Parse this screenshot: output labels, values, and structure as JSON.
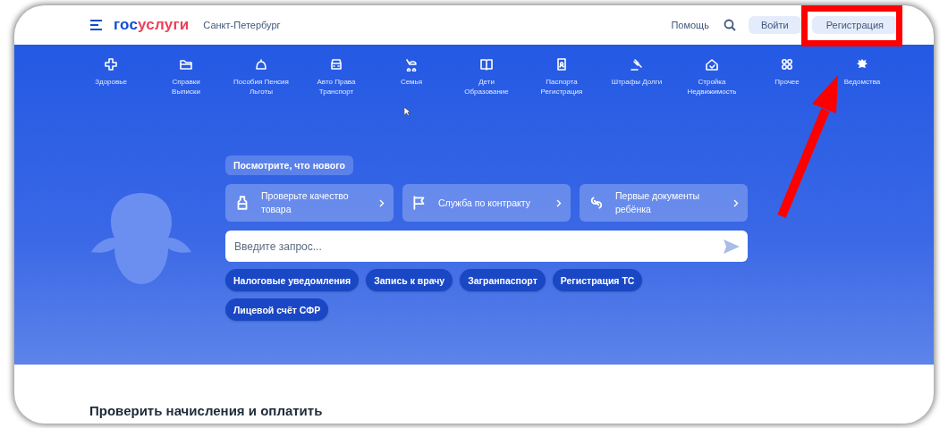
{
  "header": {
    "logo": [
      {
        "text": "гос",
        "color": "#0d4cd3"
      },
      {
        "text": "услуги",
        "color": "#ee3f58"
      }
    ],
    "city": "Санкт-Петербург",
    "help": "Помощь",
    "login": "Войти",
    "register": "Регистрация"
  },
  "categories": [
    {
      "label": "Здоровье"
    },
    {
      "label": "Справки Выписки"
    },
    {
      "label": "Пособия Пенсия Льготы"
    },
    {
      "label": "Авто Права Транспорт"
    },
    {
      "label": "Семья"
    },
    {
      "label": "Дети Образование"
    },
    {
      "label": "Паспорта Регистрация"
    },
    {
      "label": "Штрафы Долги"
    },
    {
      "label": "Стройка Недвижимость"
    },
    {
      "label": "Прочее"
    },
    {
      "label": "Ведомства"
    }
  ],
  "news_button": "Посмотрите, что нового",
  "promo_cards": [
    {
      "text": "Проверьте качество товара"
    },
    {
      "text": "Служба по контракту"
    },
    {
      "text": "Первые документы ребёнка"
    }
  ],
  "search": {
    "placeholder": "Введите запрос..."
  },
  "quick_links": [
    "Налоговые уведомления",
    "Запись к врачу",
    "Загранпаспорт",
    "Регистрация ТС",
    "Лицевой счёт СФР"
  ],
  "section_title": "Проверить начисления и оплатить",
  "annotations": {
    "highlight_box": {
      "color": "#ff0000"
    },
    "arrow": {
      "color": "#ff0000"
    }
  }
}
